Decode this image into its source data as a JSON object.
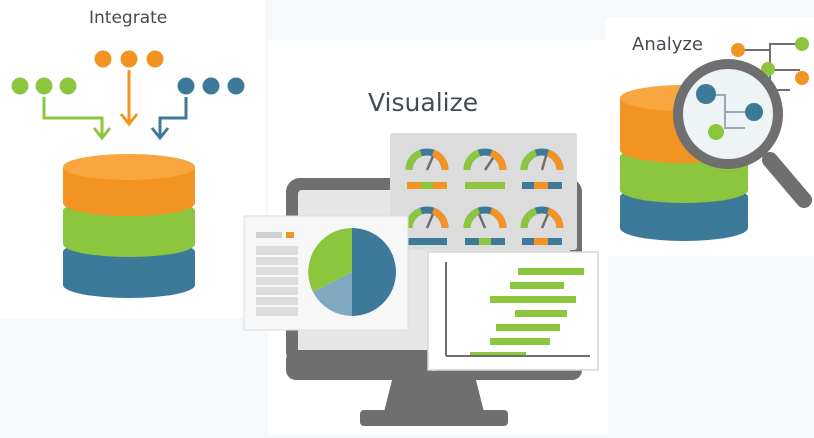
{
  "sections": {
    "integrate": {
      "label": "Integrate"
    },
    "visualize": {
      "label": "Visualize"
    },
    "analyze": {
      "label": "Analyze"
    }
  },
  "colors": {
    "orange": "#f39322",
    "green": "#8cc63f",
    "blue": "#3d7a9a",
    "gray": "#6f6f6f",
    "light_gray": "#e6e6e6"
  },
  "icons": [
    "database-icon",
    "monitor-icon",
    "dashboard-card-icon",
    "gauge-icon",
    "pie-chart-icon",
    "bar-chart-icon",
    "magnifier-icon",
    "tree-diagram-icon"
  ]
}
